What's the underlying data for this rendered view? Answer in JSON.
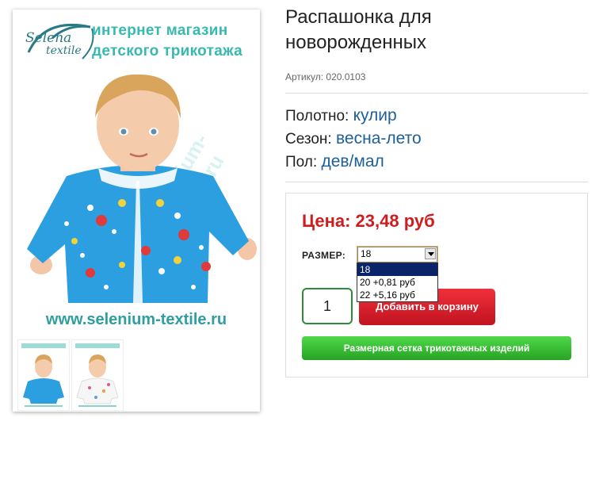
{
  "product": {
    "title_line1": "Распашонка для",
    "title_line2": "новорожденных",
    "sku": "Артикул: 020.0103"
  },
  "image": {
    "logo_selena": "Selena",
    "logo_textile": "textile",
    "shop_line1": "интернет магазин",
    "shop_line2": "детского трикотажа",
    "watermark": "selenium-textile.ru",
    "site_url": "www.selenium-textile.ru"
  },
  "properties": [
    {
      "label": "Полотно:",
      "value": "кулир"
    },
    {
      "label": "Сезон:",
      "value": "весна-лето"
    },
    {
      "label": "Пол:",
      "value": "дев/мал"
    }
  ],
  "buy": {
    "price": "Цена: 23,48 руб",
    "size_label": "РАЗМЕР:",
    "size_selected": "18",
    "size_options": [
      "18",
      "20 +0,81 руб",
      "22 +5,16 руб"
    ],
    "quantity": "1",
    "add_to_cart": "Добавить в корзину",
    "size_chart": "Размерная сетка трикотажных изделий"
  },
  "colors": {
    "price": "#cc1e1e",
    "property_value": "#1e5f98",
    "add_to_cart": "#e0202c",
    "size_chart": "#3cc036",
    "dropdown_active": "#0a246a",
    "brand_teal": "#37b9b0"
  }
}
